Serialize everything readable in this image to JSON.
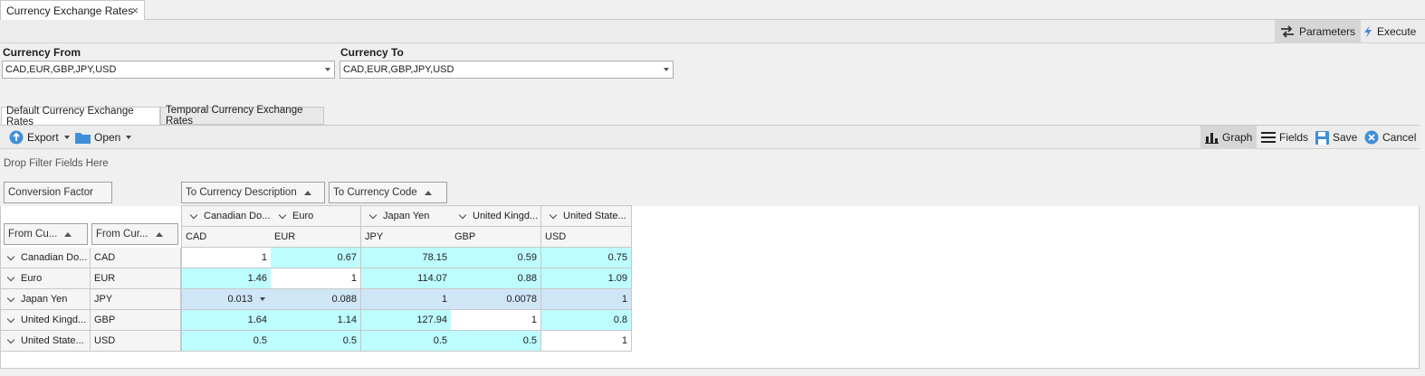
{
  "window": {
    "tab_title": "Currency Exchange Rates"
  },
  "toolbar": {
    "parameters_label": "Parameters",
    "execute_label": "Execute"
  },
  "params": {
    "from_label": "Currency From",
    "from_value": "CAD,EUR,GBP,JPY,USD",
    "to_label": "Currency To",
    "to_value": "CAD,EUR,GBP,JPY,USD"
  },
  "tabs": [
    {
      "label": "Default Currency Exchange Rates"
    },
    {
      "label": "Temporal Currency Exchange Rates"
    }
  ],
  "pivot_toolbar": {
    "export_label": "Export",
    "open_label": "Open",
    "graph_label": "Graph",
    "fields_label": "Fields",
    "save_label": "Save",
    "cancel_label": "Cancel"
  },
  "pivot": {
    "filter_hint": "Drop Filter Fields Here",
    "data_field": "Conversion Factor",
    "column_fields": [
      "To Currency Description",
      "To Currency Code"
    ],
    "row_fields": [
      "From Cu...",
      "From Cur..."
    ],
    "columns": [
      {
        "desc": "Canadian Do...",
        "code": "CAD"
      },
      {
        "desc": "Euro",
        "code": "EUR"
      },
      {
        "desc": "Japan Yen",
        "code": "JPY"
      },
      {
        "desc": "United Kingd...",
        "code": "GBP"
      },
      {
        "desc": "United State...",
        "code": "USD"
      }
    ],
    "rows": [
      {
        "desc": "Canadian Do...",
        "code": "CAD",
        "values": [
          "1",
          "0.67",
          "78.15",
          "0.59",
          "0.75"
        ]
      },
      {
        "desc": "Euro",
        "code": "EUR",
        "values": [
          "1.46",
          "1",
          "114.07",
          "0.88",
          "1.09"
        ]
      },
      {
        "desc": "Japan Yen",
        "code": "JPY",
        "values": [
          "0.013",
          "0.088",
          "1",
          "0.0078",
          "1"
        ]
      },
      {
        "desc": "United Kingd...",
        "code": "GBP",
        "values": [
          "1.64",
          "1.14",
          "127.94",
          "1",
          "0.8"
        ]
      },
      {
        "desc": "United State...",
        "code": "USD",
        "values": [
          "0.5",
          "0.5",
          "0.5",
          "0.5",
          "1"
        ]
      }
    ]
  },
  "colors": {
    "cell_highlight": "#bdfcff",
    "selected_row": "#cfe6f7",
    "accent": "#1e73be"
  }
}
